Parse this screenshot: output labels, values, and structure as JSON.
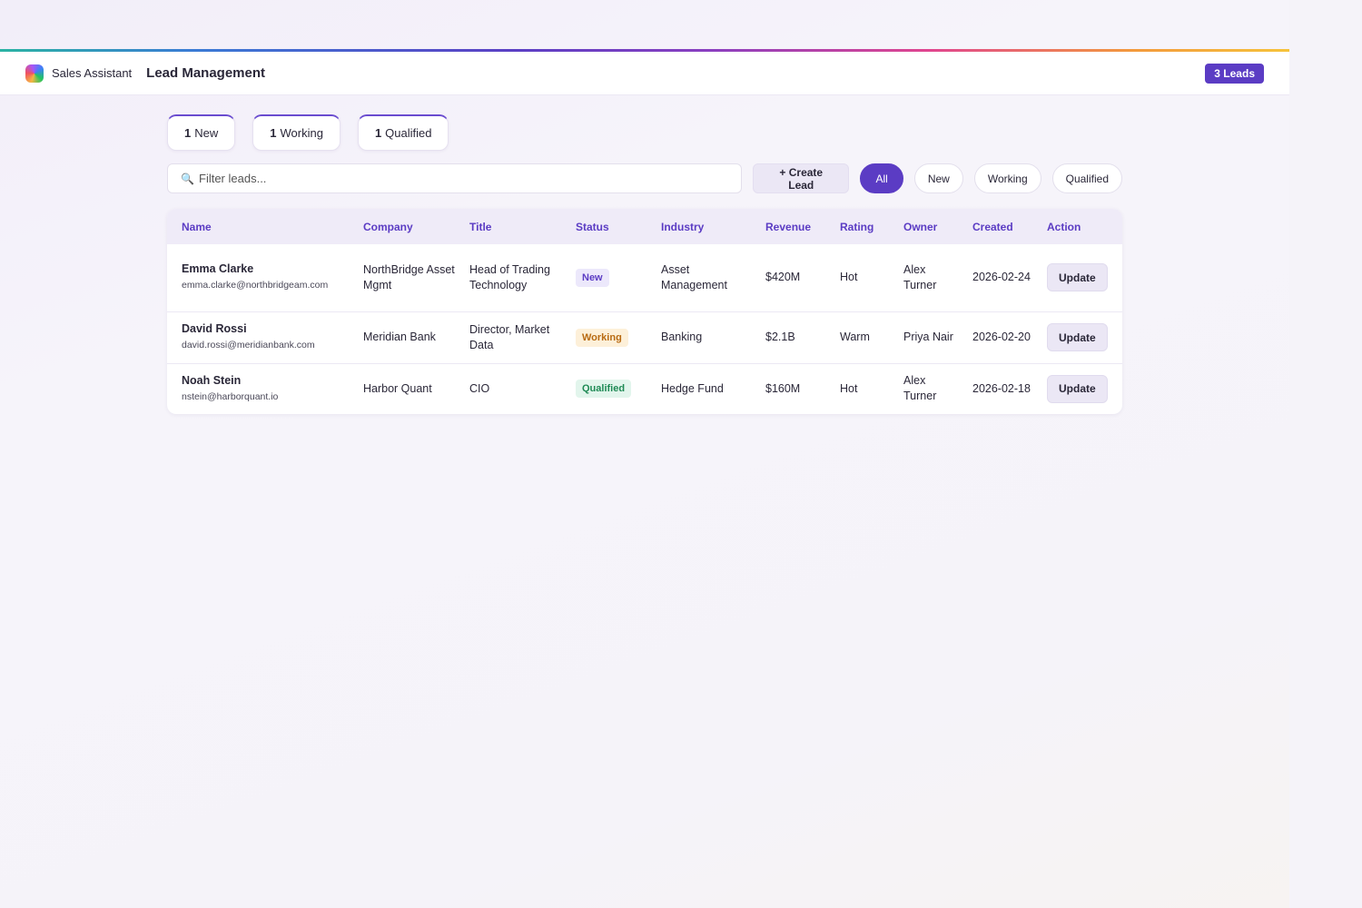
{
  "header": {
    "brand": "Sales Assistant",
    "page_title": "Lead Management",
    "leads_badge": "3 Leads"
  },
  "stats": [
    {
      "count": "1",
      "label": "New"
    },
    {
      "count": "1",
      "label": "Working"
    },
    {
      "count": "1",
      "label": "Qualified"
    }
  ],
  "toolbar": {
    "search_placeholder": "Filter leads...",
    "search_value": "",
    "create_label": "+ Create Lead",
    "filters": [
      "All",
      "New",
      "Working",
      "Qualified"
    ],
    "active_filter": "All"
  },
  "table": {
    "columns": [
      "Name",
      "Company",
      "Title",
      "Status",
      "Industry",
      "Revenue",
      "Rating",
      "Owner",
      "Created",
      "Action"
    ],
    "rows": [
      {
        "name": "Emma Clarke",
        "email": "emma.clarke@northbridgeam.com",
        "company": "NorthBridge Asset Mgmt",
        "title": "Head of Trading Technology",
        "status": "New",
        "industry": "Asset Management",
        "revenue": "$420M",
        "rating": "Hot",
        "owner": "Alex Turner",
        "created": "2026-02-24",
        "action": "Update"
      },
      {
        "name": "David Rossi",
        "email": "david.rossi@meridianbank.com",
        "company": "Meridian Bank",
        "title": "Director, Market Data",
        "status": "Working",
        "industry": "Banking",
        "revenue": "$2.1B",
        "rating": "Warm",
        "owner": "Priya Nair",
        "created": "2026-02-20",
        "action": "Update"
      },
      {
        "name": "Noah Stein",
        "email": "nstein@harborquant.io",
        "company": "Harbor Quant",
        "title": "CIO",
        "status": "Qualified",
        "industry": "Hedge Fund",
        "revenue": "$160M",
        "rating": "Hot",
        "owner": "Alex Turner",
        "created": "2026-02-18",
        "action": "Update"
      }
    ]
  },
  "colors": {
    "accent": "#5b3cc4",
    "status_new_bg": "#ece8fb",
    "status_new_fg": "#5b3cc4",
    "status_working_bg": "#fdf0d9",
    "status_working_fg": "#b86a12",
    "status_qualified_bg": "#e2f5ec",
    "status_qualified_fg": "#1f8a55"
  },
  "icons": {
    "search": "magnifier-icon",
    "logo": "app-logo-icon"
  }
}
